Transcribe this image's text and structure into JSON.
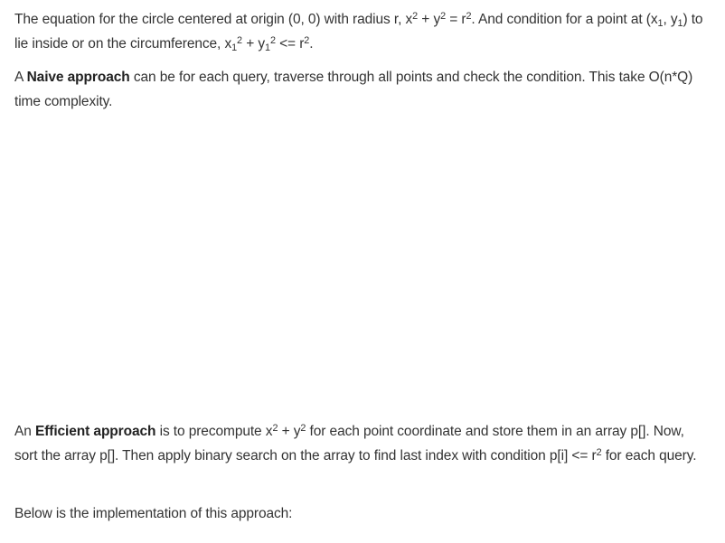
{
  "para1": {
    "t1": "The equation for the circle centered at origin (0, 0) with radius r, x",
    "s1": "2",
    "t2": " + y",
    "s2": "2",
    "t3": " = r",
    "s3": "2",
    "t4": ". And condition for a point at (x",
    "b1": "1",
    "t5": ", y",
    "b2": "1",
    "t6": ") to lie inside or on the circumference, x",
    "b3": "1",
    "s4": "2",
    "t7": " + y",
    "b4": "1",
    "s5": "2",
    "t8": " <= r",
    "s6": "2",
    "t9": "."
  },
  "para2": {
    "t1": "A ",
    "bold": "Naive approach",
    "t2": " can be for each query, traverse through all points and check the condition. This take O(n*Q) time complexity."
  },
  "para3": {
    "t1": "An ",
    "bold": "Efficient approach",
    "t2": " is to precompute x",
    "s1": "2",
    "t3": " + y",
    "s2": "2",
    "t4": " for each point coordinate and store them in an array p[]. Now, sort the array p[]. Then apply binary search on the array to find last index with condition p[i] <= r",
    "s3": "2",
    "t5": " for each query."
  },
  "para4": {
    "text": "Below is the implementation of this approach:"
  }
}
